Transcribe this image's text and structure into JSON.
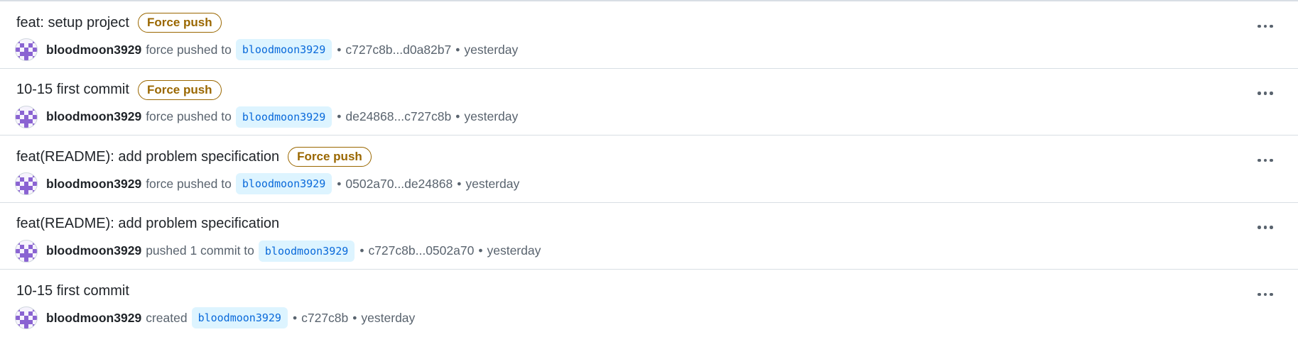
{
  "colors": {
    "badge": "#9a6700",
    "branch_text": "#0969da",
    "branch_bg": "#ddf4ff",
    "muted_text": "#59636e",
    "avatar": "#8a63d2"
  },
  "icons": {
    "avatar": "identicon-avatar",
    "more": "kebab-horizontal-icon"
  },
  "timeline": [
    {
      "title": "feat: setup project",
      "badge": "Force push",
      "author": "bloodmoon3929",
      "action": "force pushed to",
      "branch": "bloodmoon3929",
      "commits": "c727c8b...d0a82b7",
      "time": "yesterday"
    },
    {
      "title": "10-15 first commit",
      "badge": "Force push",
      "author": "bloodmoon3929",
      "action": "force pushed to",
      "branch": "bloodmoon3929",
      "commits": "de24868...c727c8b",
      "time": "yesterday"
    },
    {
      "title": "feat(README): add problem specification",
      "badge": "Force push",
      "author": "bloodmoon3929",
      "action": "force pushed to",
      "branch": "bloodmoon3929",
      "commits": "0502a70...de24868",
      "time": "yesterday"
    },
    {
      "title": "feat(README): add problem specification",
      "author": "bloodmoon3929",
      "action": "pushed 1 commit to",
      "branch": "bloodmoon3929",
      "commits": "c727c8b...0502a70",
      "time": "yesterday"
    },
    {
      "title": "10-15 first commit",
      "author": "bloodmoon3929",
      "action": "created",
      "branch": "bloodmoon3929",
      "commits": "c727c8b",
      "time": "yesterday"
    }
  ]
}
